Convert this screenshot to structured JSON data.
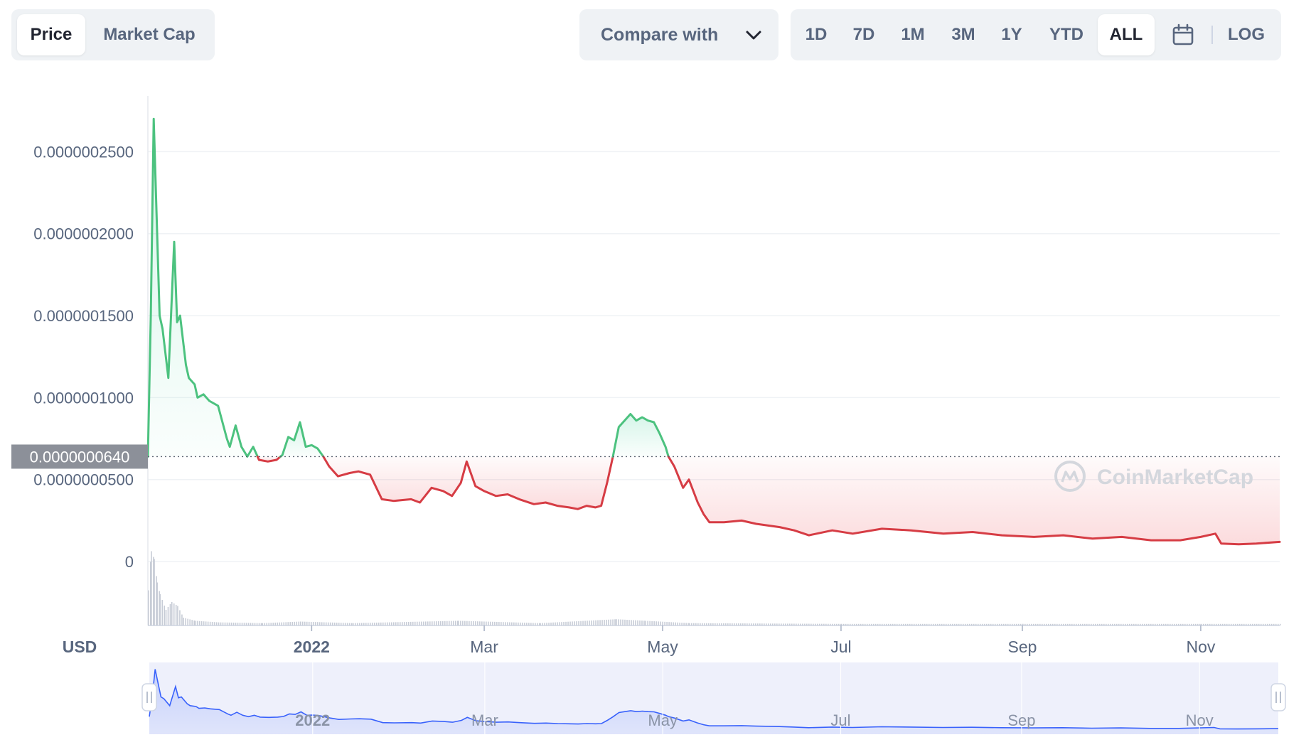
{
  "tabs": {
    "items": [
      {
        "label": "Price",
        "active": true
      },
      {
        "label": "Market Cap",
        "active": false
      }
    ]
  },
  "compare": {
    "label": "Compare with",
    "icon": "chevron-down-icon"
  },
  "ranges": {
    "items": [
      {
        "label": "1D",
        "active": false
      },
      {
        "label": "7D",
        "active": false
      },
      {
        "label": "1M",
        "active": false
      },
      {
        "label": "3M",
        "active": false
      },
      {
        "label": "1Y",
        "active": false
      },
      {
        "label": "YTD",
        "active": false
      },
      {
        "label": "ALL",
        "active": true
      }
    ],
    "calendar_icon": "calendar-icon",
    "log_label": "LOG"
  },
  "colors": {
    "up": "#16c784",
    "down": "#ea3943",
    "navigator": "#3861fb",
    "grid": "#eff2f5",
    "axis_text": "#58667e"
  },
  "chart_data": {
    "type": "line",
    "currency_label": "USD",
    "watermark": "CoinMarketCap",
    "reference_value": 6.4e-08,
    "reference_label": "0.0000000640",
    "y_ticks": [
      {
        "value": 0,
        "label": "0"
      },
      {
        "value": 5e-08,
        "label": "0.0000000500"
      },
      {
        "value": 1e-07,
        "label": "0.0000001000"
      },
      {
        "value": 1.5e-07,
        "label": "0.0000001500"
      },
      {
        "value": 2e-07,
        "label": "0.0000002000"
      },
      {
        "value": 2.5e-07,
        "label": "0.0000002500"
      }
    ],
    "ylim": [
      -3.9e-08,
      2.84e-07
    ],
    "x_range": [
      "2021-11-06",
      "2022-11-28"
    ],
    "x_ticks": [
      {
        "date": "2022-01-01",
        "label": "2022",
        "bold": true
      },
      {
        "date": "2022-03-01",
        "label": "Mar",
        "bold": false
      },
      {
        "date": "2022-05-01",
        "label": "May",
        "bold": false
      },
      {
        "date": "2022-07-01",
        "label": "Jul",
        "bold": false
      },
      {
        "date": "2022-09-01",
        "label": "Sep",
        "bold": false
      },
      {
        "date": "2022-11-01",
        "label": "Nov",
        "bold": false
      }
    ],
    "series": [
      {
        "points": [
          [
            "2021-11-06",
            6.4e-08
          ],
          [
            "2021-11-07",
            1.5e-07
          ],
          [
            "2021-11-08",
            2.7e-07
          ],
          [
            "2021-11-10",
            1.5e-07
          ],
          [
            "2021-11-11",
            1.42e-07
          ],
          [
            "2021-11-13",
            1.12e-07
          ],
          [
            "2021-11-15",
            1.95e-07
          ],
          [
            "2021-11-16",
            1.46e-07
          ],
          [
            "2021-11-17",
            1.5e-07
          ],
          [
            "2021-11-19",
            1.2e-07
          ],
          [
            "2021-11-20",
            1.12e-07
          ],
          [
            "2021-11-22",
            1.08e-07
          ],
          [
            "2021-11-23",
            1e-07
          ],
          [
            "2021-11-25",
            1.02e-07
          ],
          [
            "2021-11-27",
            9.8e-08
          ],
          [
            "2021-11-30",
            9.5e-08
          ],
          [
            "2021-12-03",
            7.5e-08
          ],
          [
            "2021-12-04",
            7e-08
          ],
          [
            "2021-12-06",
            8.3e-08
          ],
          [
            "2021-12-08",
            7e-08
          ],
          [
            "2021-12-10",
            6.4e-08
          ],
          [
            "2021-12-12",
            7e-08
          ],
          [
            "2021-12-14",
            6.2e-08
          ],
          [
            "2021-12-17",
            6.1e-08
          ],
          [
            "2021-12-20",
            6.2e-08
          ],
          [
            "2021-12-22",
            6.5e-08
          ],
          [
            "2021-12-24",
            7.6e-08
          ],
          [
            "2021-12-26",
            7.4e-08
          ],
          [
            "2021-12-28",
            8.5e-08
          ],
          [
            "2021-12-30",
            7e-08
          ],
          [
            "2022-01-01",
            7.1e-08
          ],
          [
            "2022-01-03",
            6.9e-08
          ],
          [
            "2022-01-05",
            6.4e-08
          ],
          [
            "2022-01-07",
            5.8e-08
          ],
          [
            "2022-01-10",
            5.2e-08
          ],
          [
            "2022-01-14",
            5.4e-08
          ],
          [
            "2022-01-17",
            5.5e-08
          ],
          [
            "2022-01-21",
            5.3e-08
          ],
          [
            "2022-01-25",
            3.8e-08
          ],
          [
            "2022-01-29",
            3.7e-08
          ],
          [
            "2022-02-04",
            3.8e-08
          ],
          [
            "2022-02-07",
            3.6e-08
          ],
          [
            "2022-02-11",
            4.5e-08
          ],
          [
            "2022-02-15",
            4.3e-08
          ],
          [
            "2022-02-18",
            4e-08
          ],
          [
            "2022-02-21",
            4.8e-08
          ],
          [
            "2022-02-23",
            6.1e-08
          ],
          [
            "2022-02-26",
            4.6e-08
          ],
          [
            "2022-03-01",
            4.3e-08
          ],
          [
            "2022-03-05",
            4e-08
          ],
          [
            "2022-03-09",
            4.1e-08
          ],
          [
            "2022-03-13",
            3.8e-08
          ],
          [
            "2022-03-18",
            3.5e-08
          ],
          [
            "2022-03-22",
            3.6e-08
          ],
          [
            "2022-03-26",
            3.4e-08
          ],
          [
            "2022-03-30",
            3.3e-08
          ],
          [
            "2022-04-02",
            3.2e-08
          ],
          [
            "2022-04-05",
            3.4e-08
          ],
          [
            "2022-04-08",
            3.3e-08
          ],
          [
            "2022-04-10",
            3.4e-08
          ],
          [
            "2022-04-12",
            4.8e-08
          ],
          [
            "2022-04-14",
            6.4e-08
          ],
          [
            "2022-04-16",
            8.2e-08
          ],
          [
            "2022-04-18",
            8.6e-08
          ],
          [
            "2022-04-20",
            9e-08
          ],
          [
            "2022-04-22",
            8.6e-08
          ],
          [
            "2022-04-24",
            8.8e-08
          ],
          [
            "2022-04-26",
            8.6e-08
          ],
          [
            "2022-04-28",
            8.5e-08
          ],
          [
            "2022-04-30",
            7.8e-08
          ],
          [
            "2022-05-02",
            7e-08
          ],
          [
            "2022-05-03",
            6.4e-08
          ],
          [
            "2022-05-05",
            5.8e-08
          ],
          [
            "2022-05-08",
            4.5e-08
          ],
          [
            "2022-05-10",
            5e-08
          ],
          [
            "2022-05-13",
            3.6e-08
          ],
          [
            "2022-05-15",
            2.9e-08
          ],
          [
            "2022-05-17",
            2.4e-08
          ],
          [
            "2022-05-22",
            2.4e-08
          ],
          [
            "2022-05-28",
            2.5e-08
          ],
          [
            "2022-06-02",
            2.3e-08
          ],
          [
            "2022-06-10",
            2.1e-08
          ],
          [
            "2022-06-15",
            1.9e-08
          ],
          [
            "2022-06-20",
            1.6e-08
          ],
          [
            "2022-06-28",
            1.9e-08
          ],
          [
            "2022-07-05",
            1.7e-08
          ],
          [
            "2022-07-15",
            2e-08
          ],
          [
            "2022-07-25",
            1.9e-08
          ],
          [
            "2022-08-05",
            1.7e-08
          ],
          [
            "2022-08-15",
            1.8e-08
          ],
          [
            "2022-08-25",
            1.6e-08
          ],
          [
            "2022-09-05",
            1.5e-08
          ],
          [
            "2022-09-15",
            1.6e-08
          ],
          [
            "2022-09-25",
            1.4e-08
          ],
          [
            "2022-10-05",
            1.5e-08
          ],
          [
            "2022-10-15",
            1.3e-08
          ],
          [
            "2022-10-25",
            1.3e-08
          ],
          [
            "2022-11-01",
            1.5e-08
          ],
          [
            "2022-11-06",
            1.7e-08
          ],
          [
            "2022-11-08",
            1.1e-08
          ],
          [
            "2022-11-14",
            1.05e-08
          ],
          [
            "2022-11-20",
            1.1e-08
          ],
          [
            "2022-11-28",
            1.2e-08
          ]
        ]
      }
    ],
    "volume": {
      "points": [
        [
          "2021-11-06",
          0.45
        ],
        [
          "2021-11-07",
          0.95
        ],
        [
          "2021-11-08",
          0.85
        ],
        [
          "2021-11-09",
          0.55
        ],
        [
          "2021-11-10",
          0.4
        ],
        [
          "2021-11-12",
          0.2
        ],
        [
          "2021-11-14",
          0.3
        ],
        [
          "2021-11-16",
          0.25
        ],
        [
          "2021-11-18",
          0.1
        ],
        [
          "2021-11-22",
          0.06
        ],
        [
          "2021-11-30",
          0.04
        ],
        [
          "2021-12-15",
          0.03
        ],
        [
          "2021-12-28",
          0.05
        ],
        [
          "2022-01-15",
          0.03
        ],
        [
          "2022-02-20",
          0.06
        ],
        [
          "2022-03-20",
          0.03
        ],
        [
          "2022-04-15",
          0.08
        ],
        [
          "2022-04-25",
          0.06
        ],
        [
          "2022-05-10",
          0.03
        ],
        [
          "2022-07-01",
          0.02
        ],
        [
          "2022-09-01",
          0.02
        ],
        [
          "2022-11-01",
          0.02
        ],
        [
          "2022-11-28",
          0.02
        ]
      ]
    }
  }
}
